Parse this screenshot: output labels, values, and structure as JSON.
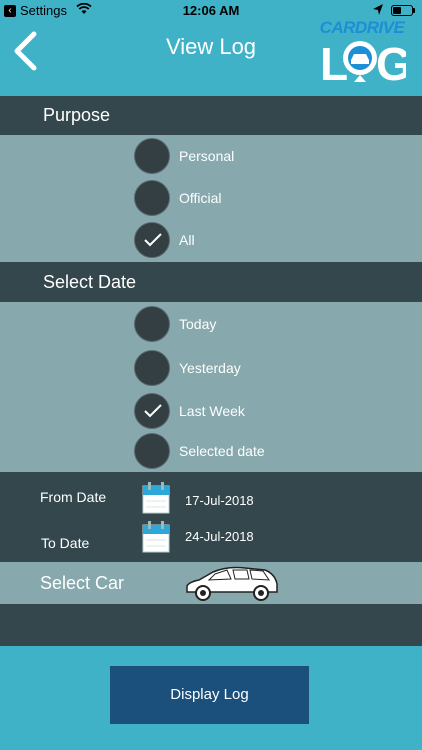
{
  "status": {
    "back_app": "Settings",
    "time": "12:06 AM"
  },
  "header": {
    "title": "View Log",
    "logo_top": "CARDRIVE",
    "logo_bottom": "LOG"
  },
  "purpose": {
    "title": "Purpose",
    "options": [
      {
        "label": "Personal",
        "checked": false
      },
      {
        "label": "Official",
        "checked": false
      },
      {
        "label": "All",
        "checked": true
      }
    ]
  },
  "select_date": {
    "title": "Select Date",
    "options": [
      {
        "label": "Today",
        "checked": false
      },
      {
        "label": "Yesterday",
        "checked": false
      },
      {
        "label": "Last Week",
        "checked": true
      },
      {
        "label": "Selected date",
        "checked": false
      }
    ]
  },
  "date_range": {
    "from_label": "From Date",
    "from_value": "17-Jul-2018",
    "to_label": "To Date",
    "to_value": "24-Jul-2018"
  },
  "car": {
    "label": "Select Car"
  },
  "action": {
    "display_label": "Display Log"
  },
  "colors": {
    "accent": "#3fb2c8",
    "dark": "#33474c",
    "panel": "#87a8ad",
    "button": "#1b4f7c"
  }
}
